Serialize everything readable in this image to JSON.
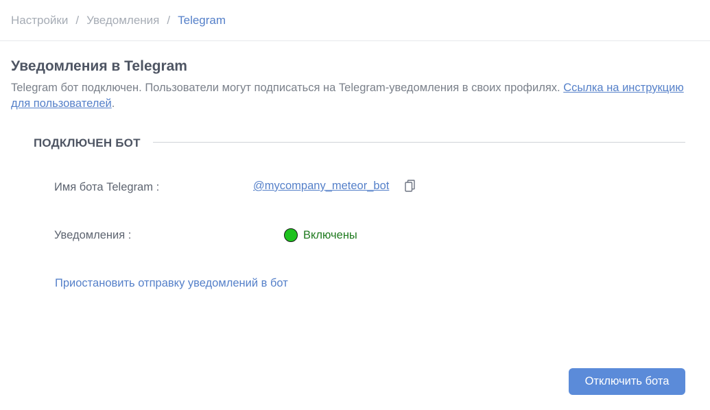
{
  "breadcrumb": {
    "items": [
      {
        "label": "Настройки"
      },
      {
        "label": "Уведомления"
      },
      {
        "label": "Telegram"
      }
    ],
    "separator": "/"
  },
  "page": {
    "title": "Уведомления в Telegram",
    "description": "Telegram бот подключен. Пользователи могут подписаться на Telegram-уведомления в своих профилях. ",
    "instruction_link": "Ссылка на инструкцию для пользователей",
    "description_end": "."
  },
  "section": {
    "title": "ПОДКЛЮЧЕН БОТ"
  },
  "fields": {
    "bot_name_label": "Имя бота Telegram",
    "bot_name_value": "@mycompany_meteor_bot",
    "notifications_label": "Уведомления",
    "notifications_status": "Включены",
    "colon": ":"
  },
  "actions": {
    "pause_link": "Приостановить отправку уведомлений в бот",
    "disconnect_button": "Отключить бота"
  },
  "icons": {
    "copy": "copy-icon",
    "status": "status-dot"
  },
  "colors": {
    "accent": "#5580c9",
    "button": "#5b8bd9",
    "status_on": "#1ec21e",
    "status_text": "#1f7a1f"
  }
}
